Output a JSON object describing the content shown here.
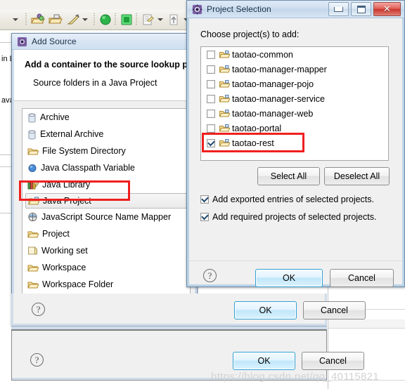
{
  "workbench": {
    "toolbar_icons": [
      "dropdown-caret",
      "open-type-icon",
      "open-resource-icon",
      "debug-last-icon",
      "toolbar-caret",
      "run-icon",
      "debug-terminate-icon",
      "external-tools-icon",
      "external-tools-caret",
      "step-icon",
      "step-caret",
      "search-icon"
    ],
    "background_fragments": [
      "in D",
      "ava"
    ]
  },
  "project_selection": {
    "title": "Project Selection",
    "icon": "eclipse-project-icon",
    "window_buttons": {
      "minimize": "minimize-icon",
      "maximize": "maximize-icon",
      "close": "✕"
    },
    "prompt": "Choose project(s) to add:",
    "projects": [
      {
        "label": "taotao-common",
        "checked": false
      },
      {
        "label": "taotao-manager-mapper",
        "checked": false
      },
      {
        "label": "taotao-manager-pojo",
        "checked": false
      },
      {
        "label": "taotao-manager-service",
        "checked": false
      },
      {
        "label": "taotao-manager-web",
        "checked": false
      },
      {
        "label": "taotao-portal",
        "checked": false
      },
      {
        "label": "taotao-rest",
        "checked": true
      }
    ],
    "select_all_label": "Select All",
    "deselect_all_label": "Deselect All",
    "options": [
      {
        "label": "Add exported entries of selected projects.",
        "checked": true
      },
      {
        "label": "Add required projects of selected projects.",
        "checked": true
      }
    ],
    "help_glyph": "?",
    "ok_label": "OK",
    "cancel_label": "Cancel",
    "highlight_color": "#ef1f1f"
  },
  "add_source": {
    "title": "Add Source",
    "icon": "eclipse-source-icon",
    "heading": "Add a container to the source lookup p",
    "subheading": "Source folders in a Java Project",
    "containers": [
      {
        "label": "Archive",
        "icon": "jar-icon",
        "selected": false
      },
      {
        "label": "External Archive",
        "icon": "jar-icon",
        "selected": false
      },
      {
        "label": "File System Directory",
        "icon": "folder-open-icon",
        "selected": false
      },
      {
        "label": "Java Classpath Variable",
        "icon": "variable-icon",
        "selected": false
      },
      {
        "label": "Java Library",
        "icon": "library-icon",
        "selected": false
      },
      {
        "label": "Java Project",
        "icon": "folder-icon",
        "selected": true
      },
      {
        "label": "JavaScript Source Name Mapper",
        "icon": "js-icon",
        "selected": false
      },
      {
        "label": "Project",
        "icon": "folder-icon",
        "selected": false
      },
      {
        "label": "Working set",
        "icon": "working-set-icon",
        "selected": false
      },
      {
        "label": "Workspace",
        "icon": "folder-icon",
        "selected": false
      },
      {
        "label": "Workspace Folder",
        "icon": "folder-icon",
        "selected": false
      }
    ],
    "help_glyph": "?",
    "ok_label": "OK",
    "cancel_label": "Cancel"
  },
  "bottom_dialog": {
    "help_glyph": "?",
    "ok_label": "OK",
    "cancel_label": "Cancel"
  },
  "watermark": "https://blog.csdn.net/qq_40115821"
}
